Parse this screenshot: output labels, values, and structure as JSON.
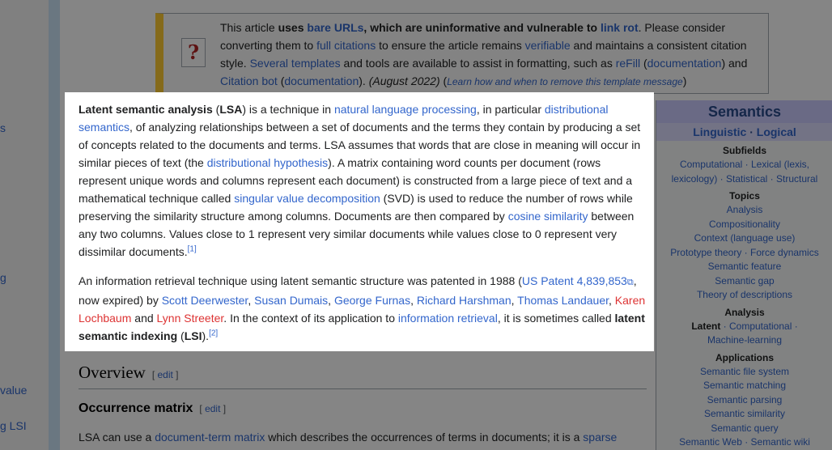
{
  "sidebar_fragments": [
    "s",
    "g",
    "value",
    "g LSI"
  ],
  "ambox": {
    "icon": "?",
    "t1": "This article ",
    "t2": "uses ",
    "l1": "bare URLs",
    "t3": ", which are uninformative and vulnerable to ",
    "l2": "link rot",
    "t4": ". Please consider converting them to ",
    "l3": "full citations",
    "t5": " to ensure the article remains ",
    "l4": "verifiable",
    "t6": " and maintains a consistent citation style. ",
    "l5": "Several templates",
    "t7": " and tools are available to assist in formatting, such as ",
    "l6": "reFill",
    "t8": " (",
    "l7": "documentation",
    "t9": ") and ",
    "l8": "Citation bot",
    "t10": " (",
    "l9": "documentation",
    "t11": "). ",
    "date": "(August 2022)",
    "t12": " (",
    "l10": "Learn how and when to remove this template message",
    "t13": ")"
  },
  "para1": {
    "b1": "Latent semantic analysis",
    "t1": " (",
    "b2": "LSA",
    "t2": ") is a technique in ",
    "l1": "natural language processing",
    "t3": ", in particular ",
    "l2": "distributional semantics",
    "t4": ", of analyzing relationships between a set of documents and the terms they contain by producing a set of concepts related to the documents and terms. LSA assumes that words that are close in meaning will occur in similar pieces of text (the ",
    "l3": "distributional hypothesis",
    "t5": "). A matrix containing word counts per document (rows represent unique words and columns represent each document) is constructed from a large piece of text and a mathematical technique called ",
    "l4": "singular value decomposition",
    "t6": " (SVD) is used to reduce the number of rows while preserving the similarity structure among columns. Documents are then compared by ",
    "l5": "cosine similarity",
    "t7": " between any two columns. Values close to 1 represent very similar documents while values close to 0 represent very dissimilar documents.",
    "ref": "[1]"
  },
  "para2": {
    "t1": "An information retrieval technique using latent semantic structure was patented in 1988 (",
    "l1": "US Patent 4,839,853",
    "ext": "⧉",
    "t2": ", now expired) by ",
    "l2": "Scott Deerwester",
    "c1": ", ",
    "l3": "Susan Dumais",
    "c2": ", ",
    "l4": "George Furnas",
    "c3": ", ",
    "l5": "Richard Harshman",
    "c4": ", ",
    "l6": "Thomas Landauer",
    "c5": ", ",
    "r1": "Karen Lochbaum",
    "t3": " and ",
    "r2": "Lynn Streeter",
    "t4": ". In the context of its application to ",
    "l7": "information retrieval",
    "t5": ", it is sometimes called ",
    "b1": "latent semantic indexing",
    "t6": " (",
    "b2": "LSI",
    "t7": ").",
    "ref": "[2]"
  },
  "overview": {
    "title": "Overview",
    "edit_open": "[ ",
    "edit": "edit",
    "edit_close": " ]"
  },
  "occurrence": {
    "title": "Occurrence matrix",
    "edit_open": "[ ",
    "edit": "edit",
    "edit_close": " ]",
    "t1": "LSA can use a ",
    "l1": "document-term matrix",
    "t2": " which describes the occurrences of terms in documents; it is a ",
    "l2": "sparse"
  },
  "infobox": {
    "title": "Semantics",
    "sub_a": "Linguistic",
    "sub_sep": " · ",
    "sub_b": "Logical",
    "subfields_head": "Subfields",
    "subfields_1": "Computational · Lexical (lexis,",
    "subfields_2": "lexicology) · Statistical · Structural",
    "topics_head": "Topics",
    "topics": [
      "Analysis",
      "Compositionality",
      "Context (language use)",
      "Prototype theory · Force dynamics",
      "Semantic feature",
      "Semantic gap",
      "Theory of descriptions"
    ],
    "analysis_head": "Analysis",
    "analysis_latent": "Latent",
    "analysis_rest": " · Computational ·",
    "analysis_2": "Machine-learning",
    "applications_head": "Applications",
    "applications": [
      "Semantic file system",
      "Semantic matching",
      "Semantic parsing",
      "Semantic similarity",
      "Semantic query",
      "Semantic Web · Semantic wiki"
    ]
  }
}
